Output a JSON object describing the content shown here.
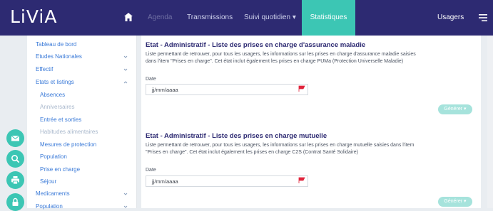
{
  "app": {
    "logo": "LiViA"
  },
  "navbar": {
    "items": [
      {
        "label": "Agenda"
      },
      {
        "label": "Transmissions"
      },
      {
        "label": "Suivi quotidien ▾"
      },
      {
        "label": "Statistiques"
      }
    ],
    "users_label": "Usagers"
  },
  "sidebar": {
    "items": [
      {
        "label": "Tableau de bord"
      },
      {
        "label": "Etudes Nationales"
      },
      {
        "label": "Effectif"
      },
      {
        "label": "Etats et listings"
      }
    ],
    "subitems": [
      {
        "label": "Absences"
      },
      {
        "label": "Anniversaires"
      },
      {
        "label": "Entrée et sorties"
      },
      {
        "label": "Habitudes alimentaires"
      },
      {
        "label": "Mesures de protection"
      },
      {
        "label": "Population"
      },
      {
        "label": "Prise en charge"
      },
      {
        "label": "Séjour"
      }
    ],
    "bottom_items": [
      {
        "label": "Medicaments"
      },
      {
        "label": "Population"
      }
    ]
  },
  "cards": [
    {
      "title": "Etat - Administratif - Liste des prises en charge d'assurance maladie",
      "description": "Liste permettant de retrouver, pour tous les usagers, les informations sur les prises en charge d'assurance maladie  saisies  dans l'item \"Prises en charge\". Cet état inclut également les prises en charge PUMa (Protection Universelle Maladie)",
      "date_label": "Date",
      "date_value": "jj/mm/aaaa",
      "button_label": "Générer ▾"
    },
    {
      "title": "Etat - Administratif - Liste des prises en charge mutuelle",
      "description": "Liste permettant de retrouver, pour tous les usagers, les informations sur les prises en charge mutuelle saisies dans l'item \"Prises en charge\". Cet état inclut également les prises en charge C2S (Contrat Santé Solidaire)",
      "date_label": "Date",
      "date_value": "jj/mm/aaaa",
      "button_label": "Générer ▾"
    }
  ],
  "colors": {
    "navbar_bg": "#2d2a72",
    "accent": "#3cc6b4",
    "link": "#3a7ad8",
    "title": "#2d2a72",
    "flag": "#e0243c"
  },
  "icons": [
    "home-icon",
    "menu-icon",
    "chevron-down-icon",
    "chevron-up-icon",
    "envelope-icon",
    "search-icon",
    "printer-icon",
    "lock-icon",
    "flag-icon"
  ]
}
